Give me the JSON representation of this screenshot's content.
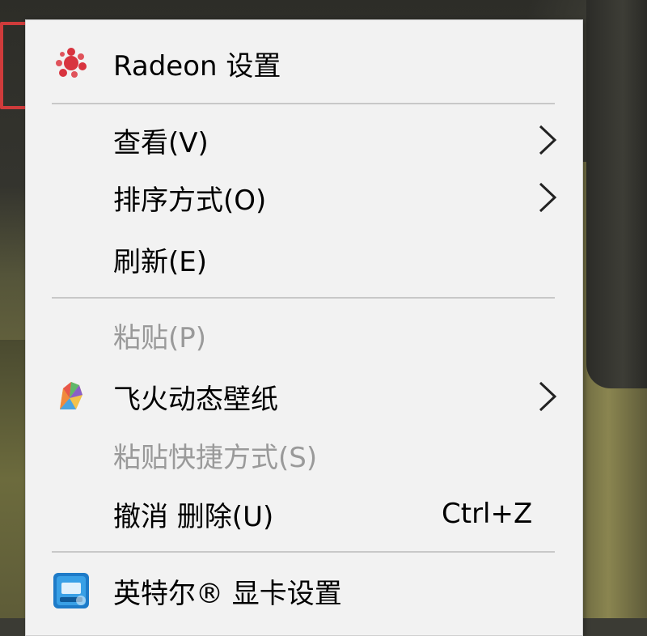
{
  "menu": {
    "items": [
      {
        "id": "radeon",
        "label": "Radeon 设置",
        "icon": "radeon-icon",
        "enabled": true,
        "submenu": false
      },
      {
        "id": "view",
        "label": "查看(V)",
        "enabled": true,
        "submenu": true
      },
      {
        "id": "sort",
        "label": "排序方式(O)",
        "enabled": true,
        "submenu": true
      },
      {
        "id": "refresh",
        "label": "刷新(E)",
        "enabled": true,
        "submenu": false
      },
      {
        "id": "paste",
        "label": "粘贴(P)",
        "enabled": false,
        "submenu": false
      },
      {
        "id": "wallpaper",
        "label": "飞火动态壁纸",
        "icon": "feihuo-wallpaper-icon",
        "enabled": true,
        "submenu": true
      },
      {
        "id": "paste_shortcut",
        "label": "粘贴快捷方式(S)",
        "enabled": false,
        "submenu": false
      },
      {
        "id": "undo",
        "label": "撤消 删除(U)",
        "shortcut": "Ctrl+Z",
        "enabled": true,
        "submenu": false
      },
      {
        "id": "intel",
        "label": "英特尔® 显卡设置",
        "icon": "intel-graphics-icon",
        "enabled": true,
        "submenu": false
      }
    ]
  },
  "colors": {
    "menu_bg": "#f2f2f2",
    "highlight_border": "#cf3b3b",
    "disabled_text": "#9a9a9a",
    "separator": "#c8c8c8"
  }
}
